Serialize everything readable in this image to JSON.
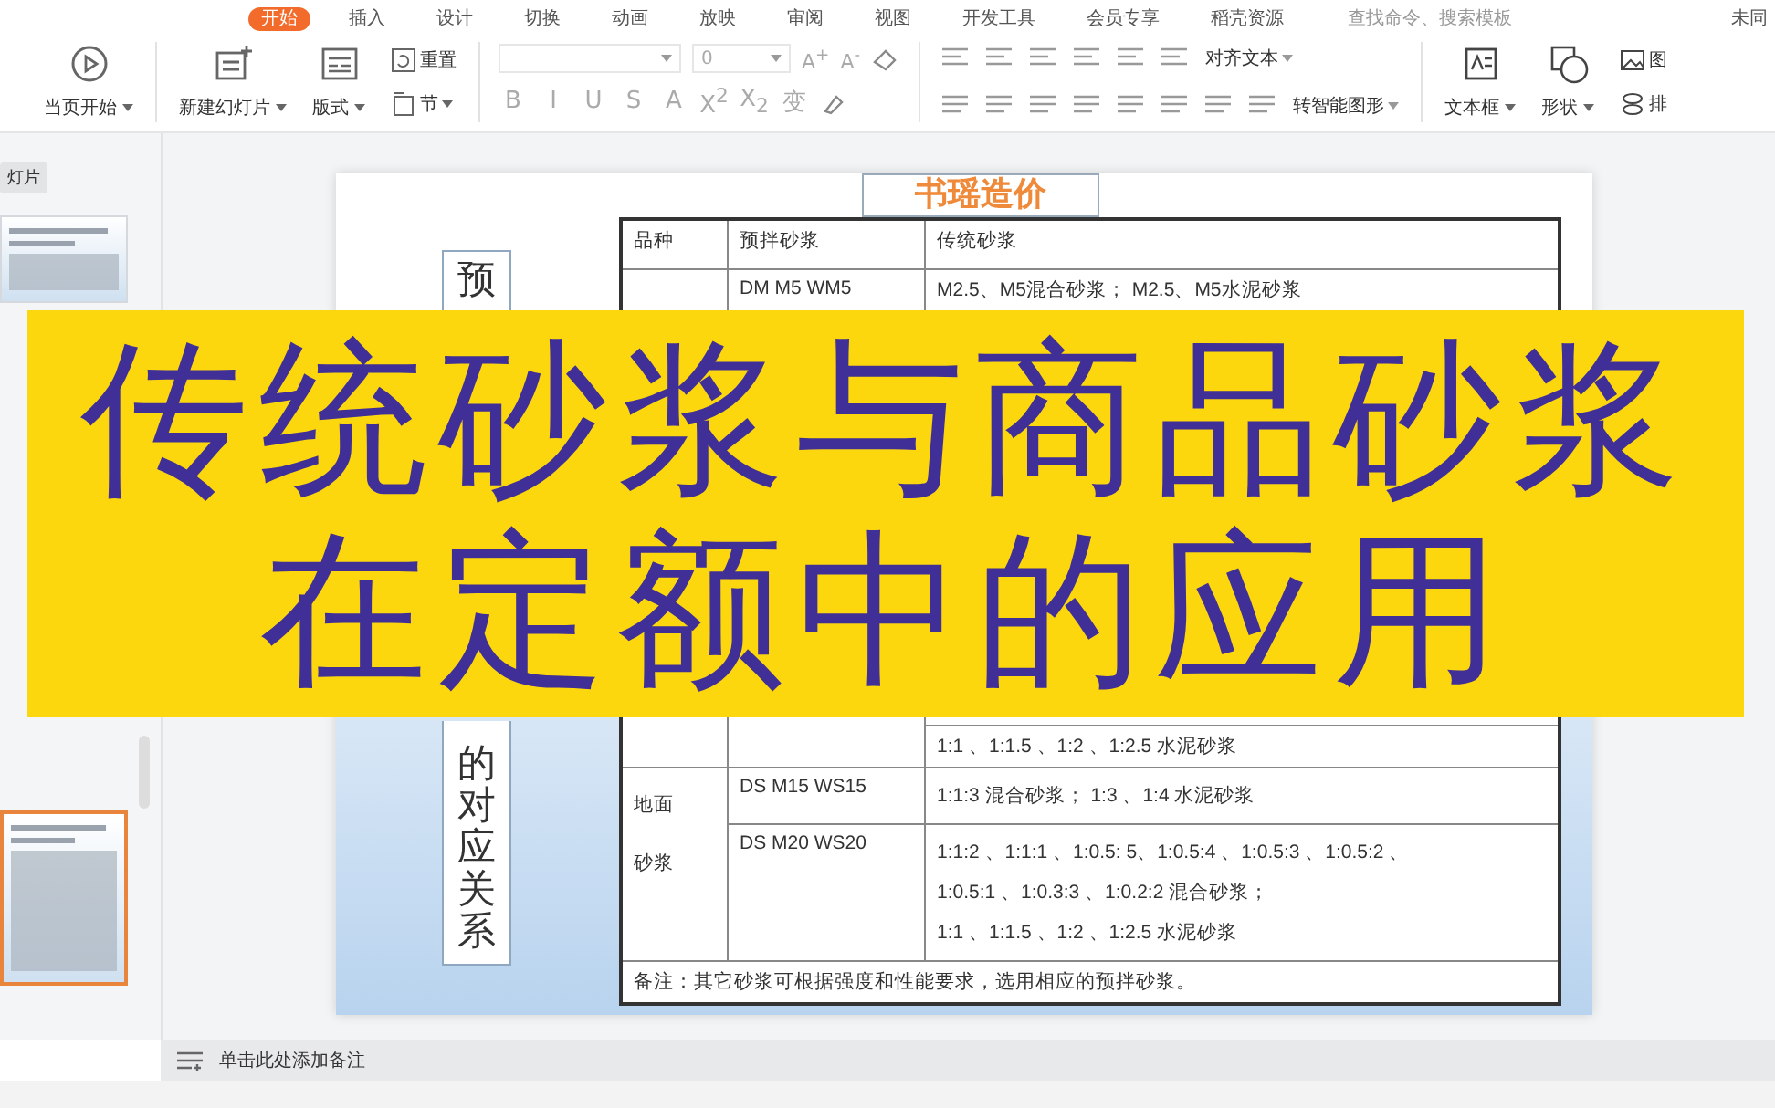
{
  "menu_tabs": [
    {
      "label": "开始",
      "selected": true
    },
    {
      "label": "插入",
      "selected": false
    },
    {
      "label": "设计",
      "selected": false
    },
    {
      "label": "切换",
      "selected": false
    },
    {
      "label": "动画",
      "selected": false
    },
    {
      "label": "放映",
      "selected": false
    },
    {
      "label": "审阅",
      "selected": false
    },
    {
      "label": "视图",
      "selected": false
    },
    {
      "label": "开发工具",
      "selected": false
    },
    {
      "label": "会员专享",
      "selected": false
    },
    {
      "label": "稻壳资源",
      "selected": false
    }
  ],
  "search": {
    "placeholder": "查找命令、搜索模板"
  },
  "sync_label": "未同",
  "ribbon": {
    "play_button": "当页开始",
    "new_slide_button": "新建幻灯片",
    "layout_button": "版式",
    "reset_button": "重置",
    "section_button": "节",
    "font_size": "0",
    "size_glyphs": [
      "A$^{+}$",
      "A$^{-}$"
    ],
    "format_glyphs": [
      "B",
      "I",
      "U",
      "S",
      "A",
      "X$^{2}$",
      "X$_{2}$",
      "变"
    ],
    "align_text_button": "对齐文本",
    "smart_graphic_button": "转智能图形",
    "textbox_button": "文本框",
    "shape_button": "形状",
    "picture_button": "图",
    "arrange_button": "排"
  },
  "panel_label": "灯片",
  "slides": [
    {
      "selected": false
    },
    {
      "selected": true
    }
  ],
  "slide": {
    "title": "书瑶造价",
    "side_top": "预",
    "side_bottom": "的对应关系",
    "table": {
      "columns": [
        "品种",
        "预拌砂浆",
        "传统砂浆"
      ],
      "first_row": {
        "premix": "DM M5  WM5",
        "traditional": "M2.5、M5混合砂浆；  M2.5、M5水泥砂浆"
      },
      "tail_line": "1:1 、1:1.5 、1:2 、1:2.5  水泥砂浆",
      "floor_category": [
        "地面",
        "砂浆"
      ],
      "floor_rows": [
        {
          "premix": "DS M15  WS15",
          "lines": [
            "1:1:3  混合砂浆；  1:3 、1:4 水泥砂浆"
          ]
        },
        {
          "premix": "DS M20  WS20",
          "lines": [
            "1:1:2 、1:1:1 、1:0.5:  5、1:0.5:4 、1:0.5:3 、1:0.5:2 、",
            "1:0.5:1 、1:0.3:3 、1:0.2:2  混合砂浆；",
            "1:1 、1:1.5 、1:2 、1:2.5  水泥砂浆"
          ]
        }
      ],
      "note": "备注：其它砂浆可根据强度和性能要求，选用相应的预拌砂浆。"
    }
  },
  "banner": {
    "lines": [
      "传统砂浆与商品砂浆",
      "在定额中的应用"
    ]
  },
  "notes_placeholder": "单击此处添加备注"
}
